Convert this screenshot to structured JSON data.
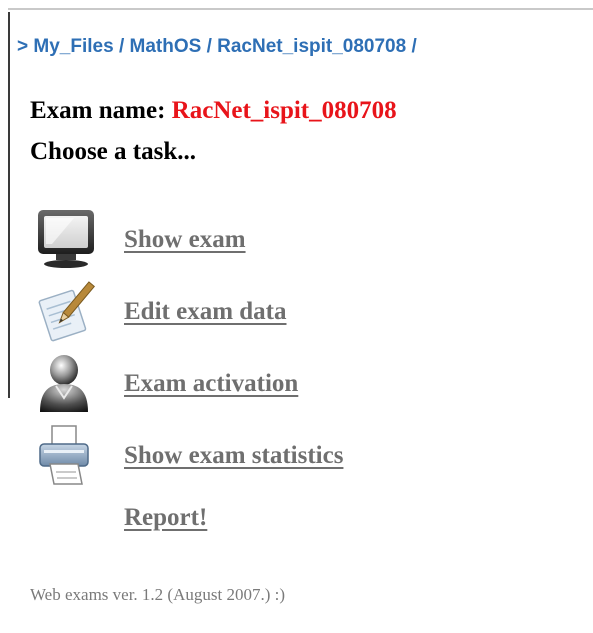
{
  "breadcrumb": {
    "prefix": ">",
    "items": [
      "My_Files",
      "MathOS",
      "RacNet_ispit_080708"
    ],
    "separator": "/"
  },
  "exam": {
    "label": "Exam name:",
    "value": "RacNet_ispit_080708",
    "value_color": "#e8141a"
  },
  "prompt": "Choose a task...",
  "tasks": [
    {
      "label": "Show exam",
      "icon": "monitor-icon"
    },
    {
      "label": "Edit exam data",
      "icon": "edit-document-icon"
    },
    {
      "label": "Exam activation",
      "icon": "user-icon"
    },
    {
      "label": "Show exam statistics",
      "icon": "printer-icon"
    },
    {
      "label": "Report!",
      "icon": ""
    }
  ],
  "footer": "Web exams ver. 1.2 (August 2007.) :)",
  "colors": {
    "link": "#2e6fb5",
    "task_link": "#6f6f6f"
  }
}
